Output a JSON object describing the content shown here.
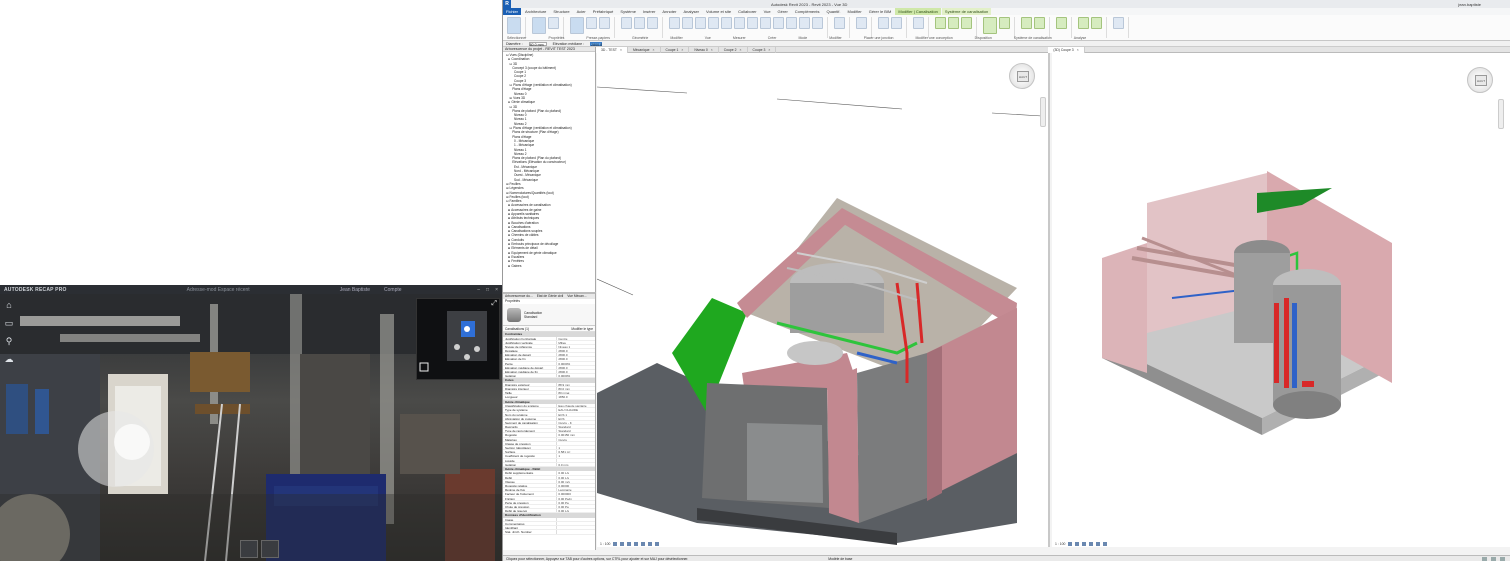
{
  "recap": {
    "brand": "AUTODESK",
    "app_name": "RECAP PRO",
    "title_center": "Adresse-mod   Espace récent",
    "user": "Jean Baptiste",
    "account": "Compte"
  },
  "revit": {
    "title": "Autodesk Revit 2023 - Revit 2023 - Vue 3D",
    "user": "jean.baptiste",
    "app_icon": "R",
    "tabs": [
      {
        "label": "Fichier"
      },
      {
        "label": "Architecture"
      },
      {
        "label": "Structure"
      },
      {
        "label": "Acier"
      },
      {
        "label": "Préfabriqué"
      },
      {
        "label": "Système"
      },
      {
        "label": "Insérer"
      },
      {
        "label": "Annoter"
      },
      {
        "label": "Analyser"
      },
      {
        "label": "Volume et site"
      },
      {
        "label": "Collaborer"
      },
      {
        "label": "Vue"
      },
      {
        "label": "Gérer"
      },
      {
        "label": "Compléments"
      },
      {
        "label": "Quantif."
      },
      {
        "label": "Modifier"
      },
      {
        "label": "Gérer le BIM"
      },
      {
        "label": "Modifier | Canalisation"
      },
      {
        "label": "Système de canalisation"
      }
    ],
    "ribbon_panels": [
      "Sélectionner",
      "Propriétés",
      "Presse-papiers",
      "Géométrie",
      "Modifier",
      "Vue",
      "Mesurer",
      "Créer",
      "Mode",
      "Modifier",
      "Placer une jonction",
      "Modifier une conception",
      "Disposition",
      "Système de canalisation",
      "Analyse"
    ],
    "options_bar": {
      "diametre_label": "Diamètre :",
      "diametre_value": "80.0 mm",
      "elevation_label": "Elévation médiane :",
      "elevation_value": "2800.0"
    },
    "browser": {
      "header": "Arborescence du projet - REVIT TEST 2023",
      "items": [
        "⊟ Vues (Discipline)",
        "  ⊟ Coordination",
        "    ⊟ 3D",
        "       Concept 3 (coupe du bâtiment)",
        "         Coupe 1",
        "         Coupe 2",
        "         Coupe 3",
        "    ⊟ Plans d'étage (ventilation et climatisation)",
        "       Plans d'étage",
        "         Niveau 0",
        "    ⊞ Vues 3D",
        "  ⊟ Génie climatique",
        "    ⊟ 3D",
        "       Plans de plafond (Plan du plafond)",
        "         Niveau 0",
        "         Niveau 1",
        "         Niveau 2",
        "    ⊟ Plans d'étage (ventilation et climatisation)",
        "       Plans de structure (Plan d'étage)",
        "       Plans d'étage",
        "         0 - Mécanique",
        "         1 - Mécanique",
        "         Niveau 1",
        "         Niveau 2",
        "       Plans de plafond (Plan du plafond)",
        "       Elévations (Elévation du constructeur)",
        "         Est - Mécanique",
        "         Nord - Mécanique",
        "         Ouest - Mécanique",
        "         Sud - Mécanique",
        "⊞ Feuilles",
        "⊞ Légendes",
        "⊞ Nomenclatures/Quantités (tout)",
        "⊞ Feuilles (tout)",
        "⊟ Familles",
        "  ⊞ Accessoires de canalisation",
        "  ⊞ Accessoires de gaine",
        "  ⊞ Appareils sanitaires",
        "  ⊞ Attributs techniques",
        "  ⊞ Bouches d'aération",
        "  ⊞ Canalisations",
        "  ⊞ Canalisations souples",
        "  ⊞ Chemins de câbles",
        "  ⊞ Conduits",
        "  ⊞ Embouts principaux de décollage",
        "  ⊞ Eléments de détail",
        "  ⊞ Equipement de génie climatique",
        "  ⊞ Escaliers",
        "  ⊞ Fenêtres",
        "  ⊞ Gaines"
      ]
    },
    "properties": {
      "tabs": [
        "Arborescence du...",
        "Etat de Génie civil",
        "Vue Mécan..."
      ],
      "header": "Propriétés",
      "type_name": "Canalisation",
      "type_sub": "Standard",
      "filter_left": "Canalisations (1)",
      "filter_right": "Modifier le type",
      "sections": [
        {
          "title": "Contraintes",
          "rows": [
            [
              "Justification horizontale",
              "Centre"
            ],
            [
              "Justification verticale",
              "Milieu"
            ],
            [
              "Niveau de référence",
              "Niveau 1"
            ],
            [
              "Décalage",
              "2800.0"
            ],
            [
              "Elévation de départ",
              "2800.0"
            ],
            [
              "Elévation de fin",
              "2800.0"
            ],
            [
              "Pente",
              "0.0000%"
            ],
            [
              "Elévation médiane de départ",
              "2800.0"
            ],
            [
              "Elévation médiane de fin",
              "2800.0"
            ],
            [
              "Isolation",
              "0.0000%"
            ]
          ]
        },
        {
          "title": "Cotes",
          "rows": [
            [
              "Diamètre extérieur",
              "88.9 mm"
            ],
            [
              "Diamètre intérieur",
              "80.0 mm"
            ],
            [
              "Taille",
              "80 mmø"
            ],
            [
              "Longueur",
              "1850.0"
            ]
          ]
        },
        {
          "title": "Génie climatique",
          "rows": [
            [
              "Classification du système",
              "Eau chaude sanitaire"
            ],
            [
              "Type de système",
              "EAU CHAUDE"
            ],
            [
              "Nom du système",
              "ECS 1"
            ],
            [
              "Abréviation du système",
              "ECS"
            ],
            [
              "Segment de canalisation",
              "Cuivre - K"
            ],
            [
              "Raccords",
              "Standard"
            ],
            [
              "Type de raccordement",
              "Standard"
            ],
            [
              "Rugosité",
              "0.00150 mm"
            ],
            [
              "Matériau",
              "Cuivre"
            ],
            [
              "Classe de pression",
              ""
            ],
            [
              "Section (décollage)",
              "1"
            ],
            [
              "Surface",
              "0.581 m²"
            ],
            [
              "Coefficient de rugosité",
              "1"
            ],
            [
              "Liquide",
              ""
            ],
            [
              "Isolation",
              "0.0 mm"
            ]
          ]
        },
        {
          "title": "Génie climatique - Débit",
          "rows": [
            [
              "Débit supplémentaire",
              "0.00 L/s"
            ],
            [
              "Débit",
              "0.00 L/s"
            ],
            [
              "Vitesse",
              "0.00 m/s"
            ],
            [
              "Rugosité relative",
              "0.00000"
            ],
            [
              "Régime de flux",
              "Laminaire"
            ],
            [
              "Facteur de frottement",
              "0.000000"
            ],
            [
              "Friction",
              "0.00 Pa/m"
            ],
            [
              "Perte de pression",
              "0.00 Pa"
            ],
            [
              "Chute de pression",
              "0.00 Pa"
            ],
            [
              "Débit de réservé",
              "0.00 L/s"
            ]
          ]
        },
        {
          "title": "Données d'identification",
          "rows": [
            [
              "Image",
              ""
            ],
            [
              "Commentaires",
              ""
            ],
            [
              "Identifiant",
              ""
            ],
            [
              "Stat. Jnrch. Number",
              ""
            ]
          ]
        }
      ]
    },
    "view_tabs": [
      {
        "label": "3D - TEST"
      },
      {
        "label": "Mécanique"
      },
      {
        "label": "Coupe 1"
      },
      {
        "label": "Niveau 0"
      },
      {
        "label": "Coupe 2"
      },
      {
        "label": "Coupe 3"
      }
    ],
    "right_view_tab": "(3D) Coupe 3",
    "viewcube_face": "HAUT",
    "left_scale": "1 : 100",
    "right_scale": "1 : 100",
    "status_text": "Cliquez pour sélectionner, Appuyez sur TAB pour d'autres options, sur CTRL pour ajouter et sur MAJ pour désélectionner.",
    "status_model": "Modèle de base"
  },
  "colors": {
    "pipe_red": "#d82828",
    "pipe_blue": "#2f62c8",
    "pipe_green": "#2ec43c",
    "wall_pink": "#d8a9ae",
    "revit_blue": "#1a5fb4",
    "ctx_tab_green": "#cfe8a9"
  }
}
